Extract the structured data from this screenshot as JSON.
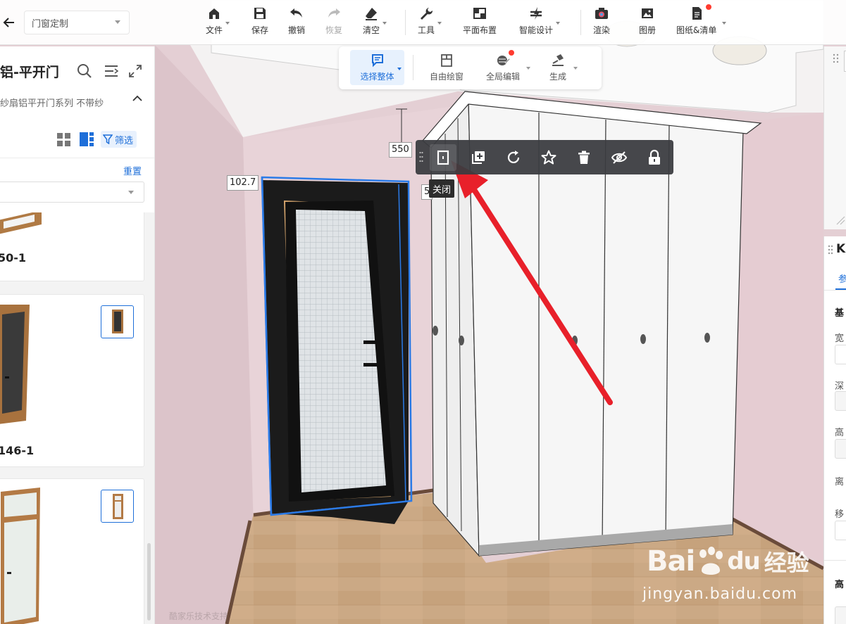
{
  "topbar": {
    "category_select": "门窗定制",
    "tools": [
      {
        "label": "文件",
        "icon": "home-icon",
        "dropdown": true
      },
      {
        "label": "保存",
        "icon": "save-icon"
      },
      {
        "label": "撤销",
        "icon": "undo-icon"
      },
      {
        "label": "恢复",
        "icon": "redo-icon",
        "disabled": true
      },
      {
        "label": "清空",
        "icon": "eraser-icon",
        "dropdown": true
      },
      {
        "label": "工具",
        "icon": "wrench-icon",
        "dropdown": true
      },
      {
        "label": "平面布置",
        "icon": "floorplan-icon"
      },
      {
        "label": "智能设计",
        "icon": "smart-design-icon",
        "dropdown": true
      },
      {
        "label": "渲染",
        "icon": "camera-icon"
      },
      {
        "label": "图册",
        "icon": "album-icon"
      },
      {
        "label": "图纸&清单",
        "icon": "drawing-list-icon",
        "dropdown": true,
        "badge": true
      }
    ]
  },
  "subbar": {
    "items": [
      {
        "label": "选择整体",
        "icon": "select-whole-icon",
        "active": true,
        "dropdown": true
      },
      {
        "label": "自由绘窗",
        "icon": "draw-window-icon"
      },
      {
        "label": "全局编辑",
        "icon": "global-edit-icon",
        "dropdown": true,
        "badge": true
      },
      {
        "label": "生成",
        "icon": "generate-icon",
        "dropdown": true
      }
    ]
  },
  "left_panel": {
    "title": "铝-平开门",
    "subtitle": "纱扇铝平开门系列   不带纱",
    "filter_label": "筛选",
    "reset_label": "重置",
    "products": [
      {
        "name": "50-1"
      },
      {
        "name": "146-1"
      },
      {
        "name": ""
      }
    ]
  },
  "object_toolbar": {
    "buttons": [
      {
        "icon": "door-close-icon"
      },
      {
        "icon": "copy-add-icon"
      },
      {
        "icon": "rotate-icon"
      },
      {
        "icon": "favorite-star-icon"
      },
      {
        "icon": "delete-trash-icon"
      },
      {
        "icon": "hide-eye-icon"
      },
      {
        "icon": "lock-icon"
      }
    ],
    "tooltip": "关闭"
  },
  "dimensions": {
    "top": "550",
    "left": "102.7",
    "right": "5"
  },
  "right_panel": {
    "header": "K",
    "tab": "参",
    "section": "基",
    "fields": [
      "宽",
      "深",
      "高",
      "离",
      "移"
    ],
    "bottom_section": "高"
  },
  "watermark": {
    "brand": "Bai",
    "brand_suffix": "经验",
    "url": "jingyan.baidu.com",
    "kujiale": "酷家乐技术支持"
  },
  "colors": {
    "accent": "#1e6fd9",
    "arrow": "#e8202a",
    "wall": "#e4cfd4",
    "floor": "#c9a882",
    "door_frame": "#1b1b1b"
  }
}
